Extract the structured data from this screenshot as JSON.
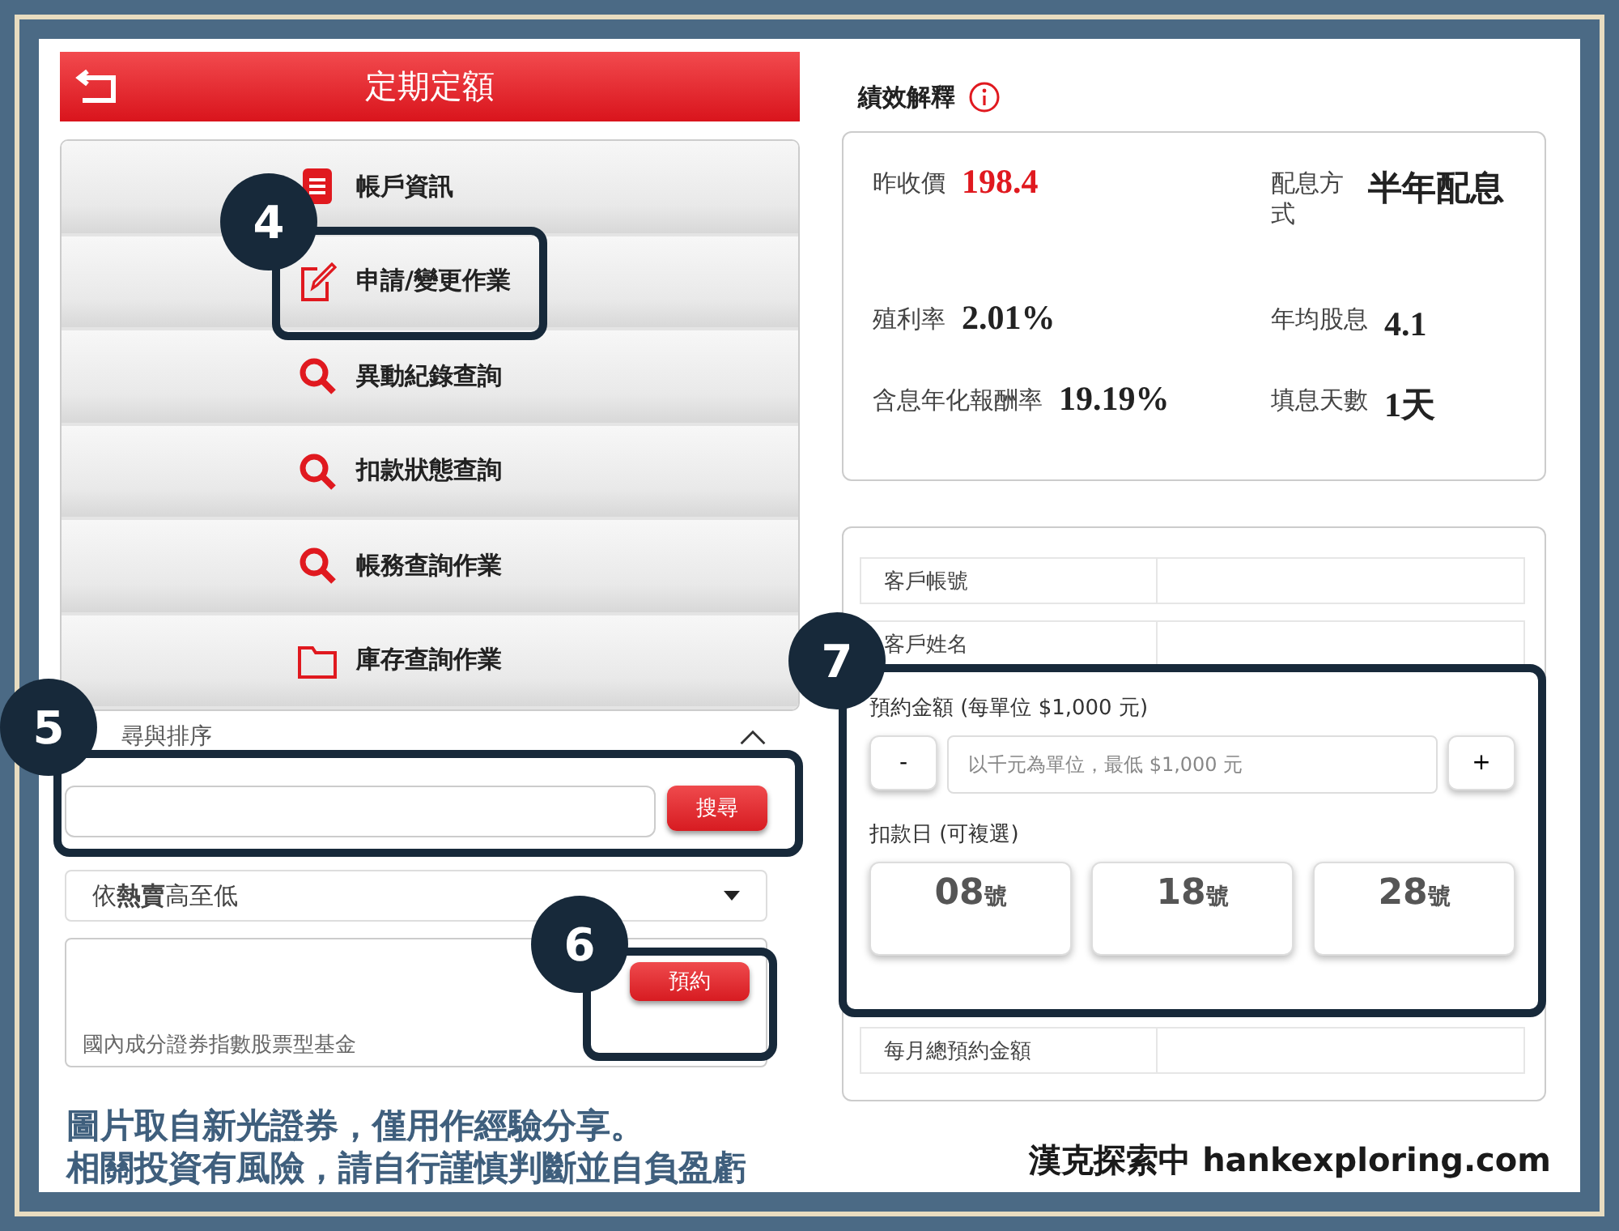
{
  "header": {
    "title": "定期定額"
  },
  "menu": [
    {
      "label": "帳戶資訊",
      "kind": "info"
    },
    {
      "label": "申請/變更作業",
      "kind": "apply"
    },
    {
      "label": "異動紀錄查詢",
      "kind": "query"
    },
    {
      "label": "扣款狀態查詢",
      "kind": "query"
    },
    {
      "label": "帳務查詢作業",
      "kind": "query"
    },
    {
      "label": "庫存查詢作業",
      "kind": "inventory"
    }
  ],
  "search_panel": {
    "title": "尋與排序",
    "expanded": true,
    "button": "搜尋",
    "sort": "依**熱賣**高至低"
  },
  "fund_card": {
    "button": "預約",
    "category": "國內成分證券指數股票型基金"
  },
  "performance": {
    "title": "績效解釋",
    "items": [
      {
        "label": "昨收價",
        "value": "198.4",
        "highlight": true
      },
      {
        "label": "配息方式",
        "value": "半年配息",
        "highlight": false
      },
      {
        "label": "殖利率",
        "value": "2.01%",
        "highlight": false
      },
      {
        "label": "年均股息",
        "value": "4.1",
        "highlight": false
      },
      {
        "label": "含息年化報酬率",
        "value": "19.19%",
        "highlight": false
      },
      {
        "label": "填息天數",
        "value": "1天",
        "highlight": false
      }
    ]
  },
  "order_form": {
    "rows": [
      {
        "label": "客戶帳號"
      },
      {
        "label": "客戶姓名"
      }
    ],
    "amount_label": "預約金額 (每單位 $1,000 元)",
    "minus": "-",
    "plus": "+",
    "amount_placeholder": "以千元為單位，最低 $1,000 元",
    "day_label": "扣款日 (可複選)",
    "days": [
      {
        "number": "08",
        "suffix": "號",
        "selected": false
      },
      {
        "number": "18",
        "suffix": "號",
        "selected": false
      },
      {
        "number": "28",
        "suffix": "號",
        "selected": false
      }
    ],
    "total_label": "每月總預約金額"
  },
  "callouts": [
    {
      "number": "4"
    },
    {
      "number": "5"
    },
    {
      "number": "6"
    },
    {
      "number": "7"
    }
  ],
  "caption": {
    "lines": [
      "圖片取自新光證券，僅用作經驗分享。",
      "相關投資有風險，請自行謹慎判斷並自負盈虧"
    ],
    "brand": "漢克探索中 hankexploring.com"
  }
}
